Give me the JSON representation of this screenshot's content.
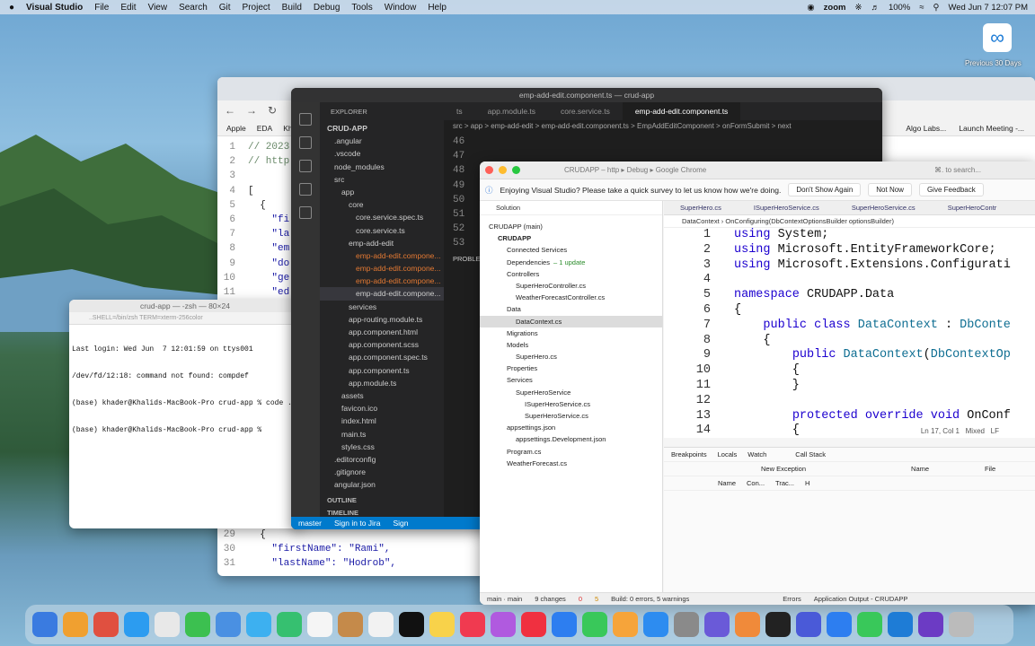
{
  "menubar": {
    "app": "Visual Studio",
    "items": [
      "File",
      "Edit",
      "View",
      "Search",
      "Git",
      "Project",
      "Build",
      "Debug",
      "Tools",
      "Window",
      "Help"
    ],
    "zoom": "zoom",
    "battery": "100%",
    "datetime": "Wed Jun 7  12:07 PM"
  },
  "desktop": {
    "label": "Previous 30 Days"
  },
  "chrome": {
    "bookmarks": [
      "Apple",
      "EDA",
      "Kh"
    ],
    "bookmarks_right": [
      "Algo Labs...",
      "Launch Meeting -..."
    ],
    "code": [
      {
        "n": "1",
        "t": "// 2023"
      },
      {
        "n": "2",
        "t": "// http"
      },
      {
        "n": "3",
        "t": ""
      },
      {
        "n": "4",
        "t": "["
      },
      {
        "n": "5",
        "t": "  {"
      },
      {
        "n": "6",
        "t": "    \"fi"
      },
      {
        "n": "7",
        "t": "    \"la"
      },
      {
        "n": "8",
        "t": "    \"em"
      },
      {
        "n": "9",
        "t": "    \"do"
      },
      {
        "n": "10",
        "t": "    \"ge"
      },
      {
        "n": "11",
        "t": "    \"ed"
      }
    ],
    "code_bottom": [
      {
        "n": "29",
        "t": "  {"
      },
      {
        "n": "30",
        "t": "    \"firstName\": \"Rami\","
      },
      {
        "n": "31",
        "t": "    \"lastName\": \"Hodrob\","
      }
    ]
  },
  "terminal": {
    "title": "crud-app — -zsh — 80×24",
    "subtitle": "..SHELL=/bin/zsh TERM=xterm-256color",
    "lines": [
      "Last login: Wed Jun  7 12:01:59 on ttys001",
      "/dev/fd/12:18: command not found: compdef",
      "(base) khader@Khalids-MacBook-Pro crud-app % code .",
      "(base) khader@Khalids-MacBook-Pro crud-app % "
    ]
  },
  "vscode": {
    "title": "emp-add-edit.component.ts — crud-app",
    "explorer_title": "EXPLORER",
    "tree": [
      {
        "label": "CRUD-APP",
        "indent": 0,
        "bold": true
      },
      {
        "label": ".angular",
        "indent": 1
      },
      {
        "label": ".vscode",
        "indent": 1
      },
      {
        "label": "node_modules",
        "indent": 1
      },
      {
        "label": "src",
        "indent": 1
      },
      {
        "label": "app",
        "indent": 2
      },
      {
        "label": "core",
        "indent": 3
      },
      {
        "label": "core.service.spec.ts",
        "indent": 4
      },
      {
        "label": "core.service.ts",
        "indent": 4
      },
      {
        "label": "emp-add-edit",
        "indent": 3
      },
      {
        "label": "emp-add-edit.compone...",
        "indent": 4,
        "red": true
      },
      {
        "label": "emp-add-edit.compone...",
        "indent": 4,
        "red": true
      },
      {
        "label": "emp-add-edit.compone...",
        "indent": 4,
        "red": true
      },
      {
        "label": "emp-add-edit.compone...",
        "indent": 4,
        "selected": true
      },
      {
        "label": "services",
        "indent": 3
      },
      {
        "label": "app-routing.module.ts",
        "indent": 3
      },
      {
        "label": "app.component.html",
        "indent": 3
      },
      {
        "label": "app.component.scss",
        "indent": 3
      },
      {
        "label": "app.component.spec.ts",
        "indent": 3
      },
      {
        "label": "app.component.ts",
        "indent": 3
      },
      {
        "label": "app.module.ts",
        "indent": 3
      },
      {
        "label": "assets",
        "indent": 2
      },
      {
        "label": "favicon.ico",
        "indent": 2
      },
      {
        "label": "index.html",
        "indent": 2
      },
      {
        "label": "main.ts",
        "indent": 2
      },
      {
        "label": "styles.css",
        "indent": 2
      },
      {
        "label": ".editorconfig",
        "indent": 1
      },
      {
        "label": ".gitignore",
        "indent": 1
      },
      {
        "label": "angular.json",
        "indent": 1
      }
    ],
    "outline": "OUTLINE",
    "timeline": "TIMELINE",
    "tabs": [
      "ts",
      "app.module.ts",
      "core.service.ts",
      "emp-add-edit.component.ts"
    ],
    "breadcrumb": "src > app > emp-add-edit > emp-add-edit.component.ts > EmpAddEditComponent > onFormSubmit > next",
    "line_numbers": [
      "46",
      "47",
      "48",
      "49",
      "50",
      "51",
      "52",
      "53"
    ],
    "panel_label": "PROBLE",
    "status": {
      "branch": "master",
      "jira": "Sign in to Jira",
      "sign": "Sign"
    }
  },
  "vs": {
    "title": "CRUDAPP – http ▸ Debug ▸ Google Chrome",
    "search_placeholder": "⌘. to search...",
    "survey": {
      "text": "Enjoying Visual Studio? Please take a quick survey to let us know how we're doing.",
      "btn1": "Don't Show Again",
      "btn2": "Not Now",
      "btn3": "Give Feedback"
    },
    "solution_title": "Solution",
    "solution_tree": [
      {
        "label": "CRUDAPP (main)",
        "indent": 0
      },
      {
        "label": "CRUDAPP",
        "indent": 1,
        "bold": true
      },
      {
        "label": "Connected Services",
        "indent": 2
      },
      {
        "label": "Dependencies",
        "indent": 2,
        "extra": "– 1 update"
      },
      {
        "label": "Controllers",
        "indent": 2
      },
      {
        "label": "SuperHeroController.cs",
        "indent": 3
      },
      {
        "label": "WeatherForecastController.cs",
        "indent": 3
      },
      {
        "label": "Data",
        "indent": 2
      },
      {
        "label": "DataContext.cs",
        "indent": 3,
        "selected": true
      },
      {
        "label": "Migrations",
        "indent": 2
      },
      {
        "label": "Models",
        "indent": 2
      },
      {
        "label": "SuperHero.cs",
        "indent": 3
      },
      {
        "label": "Properties",
        "indent": 2
      },
      {
        "label": "Services",
        "indent": 2
      },
      {
        "label": "SuperHeroService",
        "indent": 3
      },
      {
        "label": "ISuperHeroService.cs",
        "indent": 4
      },
      {
        "label": "SuperHeroService.cs",
        "indent": 4
      },
      {
        "label": "appsettings.json",
        "indent": 2
      },
      {
        "label": "appsettings.Development.json",
        "indent": 3
      },
      {
        "label": "Program.cs",
        "indent": 2
      },
      {
        "label": "WeatherForecast.cs",
        "indent": 2
      }
    ],
    "editor_tabs": [
      "SuperHero.cs",
      "ISuperHeroService.cs",
      "SuperHeroService.cs",
      "SuperHeroContr"
    ],
    "editor_crumbs": "DataContext  ›  OnConfiguring(DbContextOptionsBuilder optionsBuilder)",
    "code": [
      {
        "n": "1",
        "html": "<span class='kw'>using</span> System;"
      },
      {
        "n": "2",
        "html": "<span class='kw'>using</span> Microsoft.EntityFrameworkCore;"
      },
      {
        "n": "3",
        "html": "<span class='kw'>using</span> Microsoft.Extensions.Configurati"
      },
      {
        "n": "4",
        "html": ""
      },
      {
        "n": "5",
        "html": "<span class='kw'>namespace</span> CRUDAPP.Data"
      },
      {
        "n": "6",
        "html": "{"
      },
      {
        "n": "7",
        "html": "    <span class='kw'>public class</span> <span class='ty'>DataContext</span> : <span class='ty'>DbConte</span>"
      },
      {
        "n": "8",
        "html": "    {"
      },
      {
        "n": "9",
        "html": "        <span class='kw'>public</span> <span class='ty'>DataContext</span>(<span class='ty'>DbContextOp</span>"
      },
      {
        "n": "10",
        "html": "        {"
      },
      {
        "n": "11",
        "html": "        }"
      },
      {
        "n": "12",
        "html": ""
      },
      {
        "n": "13",
        "html": "        <span class='kw'>protected override void</span> OnConf"
      },
      {
        "n": "14",
        "html": "        {"
      }
    ],
    "cursor_pos": "Ln 17, Col 1",
    "indent": "Mixed",
    "eol": "LF",
    "breakpoints_tab": "Breakpoints",
    "locals_tab": "Locals",
    "watch_tab": "Watch",
    "callstack_tab": "Call Stack",
    "new_exception": "New Exception",
    "bp_cols": [
      "Name",
      "Con...",
      "Trac...",
      "H"
    ],
    "cs_cols": [
      "Name",
      "File"
    ],
    "status": {
      "branch": "main · main",
      "changes": "9 changes",
      "errors": "0",
      "warnings": "5",
      "build": "Build: 0 errors, 5 warnings",
      "errors_tab": "Errors",
      "output": "Application Output - CRUDAPP"
    }
  },
  "dock": {
    "colors": [
      "#3a7be0",
      "#f0a030",
      "#e05040",
      "#2c9cf0",
      "#e8e8e8",
      "#3cc050",
      "#4a90e2",
      "#3db0f0",
      "#36c070",
      "#f5f5f5",
      "#c58a4a",
      "#f2f2f2",
      "#111",
      "#f8d24a",
      "#f03a50",
      "#b05adf",
      "#f03040",
      "#2d7ef0",
      "#39c85a",
      "#f6a43a",
      "#2d8cf0",
      "#8a8a8a",
      "#6a5ad8",
      "#f08a3a",
      "#222",
      "#4a5ad8",
      "#2d7ef0",
      "#39c85a",
      "#1e7cd6",
      "#6c3bc4",
      "#bbbbbb"
    ]
  }
}
